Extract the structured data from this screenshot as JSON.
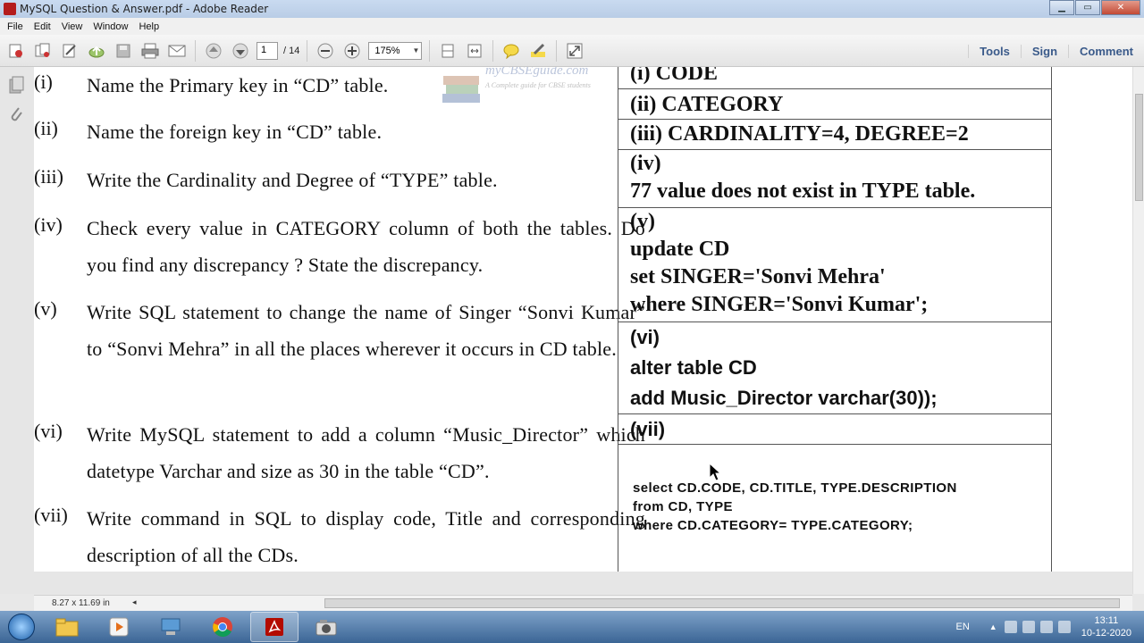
{
  "window": {
    "title": "MySQL Question & Answer.pdf - Adobe Reader",
    "min_label": "▁",
    "max_label": "▭",
    "close_label": "✕"
  },
  "menu": [
    "File",
    "Edit",
    "View",
    "Window",
    "Help"
  ],
  "toolbar": {
    "page_current": "1",
    "page_total": "/ 14",
    "zoom": "175%",
    "tools_label": "Tools",
    "sign_label": "Sign",
    "comment_label": "Comment"
  },
  "logo": {
    "brand": "myCBSEguide.com",
    "tagline": "A Complete guide for CBSE students"
  },
  "questions": [
    {
      "num": "(i)",
      "text": "Name the Primary key in “CD” table."
    },
    {
      "num": "(ii)",
      "text": "Name the foreign key in “CD” table."
    },
    {
      "num": "(iii)",
      "text": "Write the Cardinality and Degree of “TYPE” table."
    },
    {
      "num": "(iv)",
      "text": "Check every value in CATEGORY column of both the tables. Do you find any discrepancy ? State the discrepancy."
    },
    {
      "num": "(v)",
      "text": "Write SQL statement to change the name of Singer “Sonvi Kumar” to “Sonvi Mehra” in all the places wherever it occurs in CD table."
    },
    {
      "num": "(vi)",
      "text": "Write MySQL statement to add a column “Music_Director” which datetype Varchar and size as 30 in the table “CD”."
    },
    {
      "num": "(vii)",
      "text": "Write command in SQL to display code, Title and corresponding description of all the CDs."
    }
  ],
  "answers": {
    "a1": "(i) CODE",
    "a2": "(ii) CATEGORY",
    "a3": "(iii) CARDINALITY=4, DEGREE=2",
    "a4_num": "(iv)",
    "a4_text": "77 value does not exist in TYPE table.",
    "a5_num": "(v)",
    "a5_l1": "update CD",
    "a5_l2": "set SINGER='Sonvi Mehra'",
    "a5_l3": "where SINGER='Sonvi  Kumar';",
    "a6_num": "(vi)",
    "a6_l1": "alter table CD",
    "a6_l2": "add Music_Director varchar(30));",
    "a7_num": "(vii)",
    "a7_l1": "select CD.CODE, CD.TITLE, TYPE.DESCRIPTION",
    "a7_l2": "from CD, TYPE",
    "a7_l3": "where CD.CATEGORY= TYPE.CATEGORY;"
  },
  "status": {
    "page_size": "8.27 x 11.69 in"
  },
  "taskbar": {
    "lang": "EN",
    "time": "13:11",
    "date": "10-12-2020"
  }
}
